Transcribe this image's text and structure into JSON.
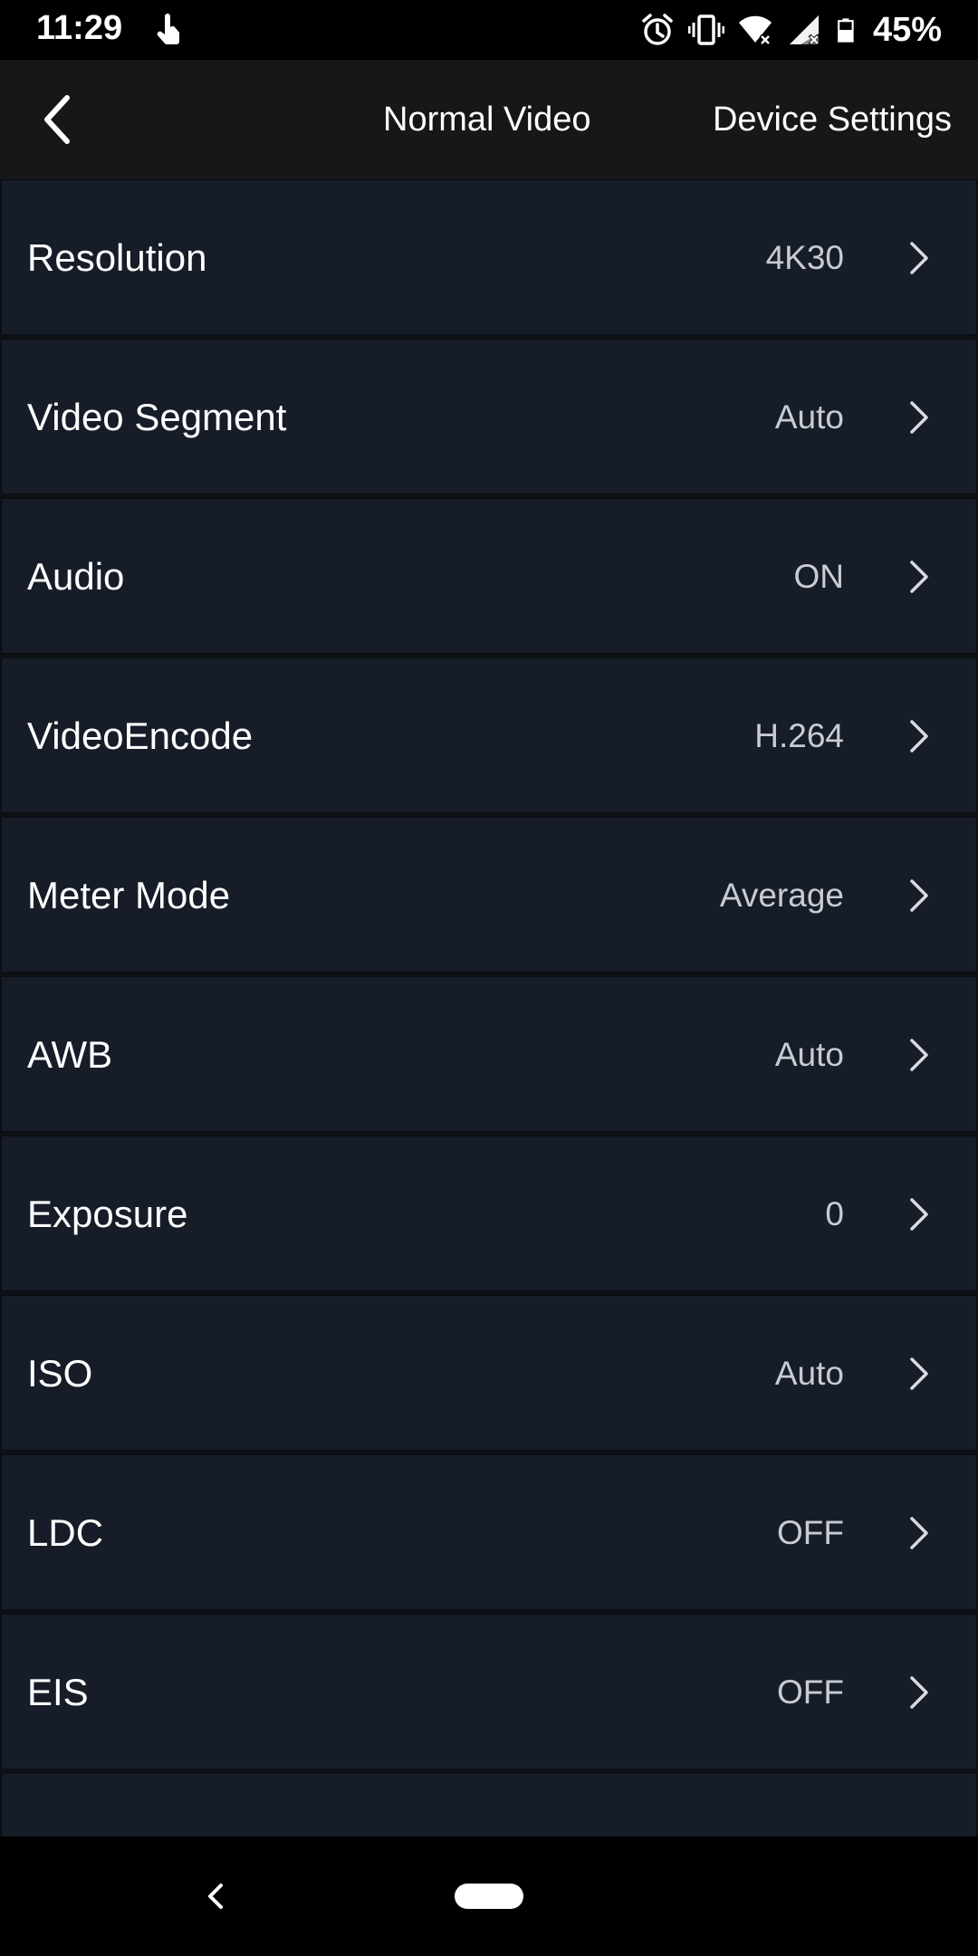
{
  "status_bar": {
    "time": "11:29",
    "battery": "45%",
    "icons": [
      "touch-icon",
      "alarm-icon",
      "vibrate-icon",
      "wifi-icon",
      "signal-icon",
      "battery-icon"
    ]
  },
  "header": {
    "back_icon": "back-arrow-icon",
    "tabs": [
      {
        "label": "Normal Video"
      },
      {
        "label": "Device Settings"
      }
    ]
  },
  "settings": {
    "items": [
      {
        "label": "Resolution",
        "value": "4K30"
      },
      {
        "label": "Video Segment",
        "value": "Auto"
      },
      {
        "label": "Audio",
        "value": "ON"
      },
      {
        "label": "VideoEncode",
        "value": "H.264"
      },
      {
        "label": "Meter Mode",
        "value": "Average"
      },
      {
        "label": "AWB",
        "value": "Auto"
      },
      {
        "label": "Exposure",
        "value": "0"
      },
      {
        "label": "ISO",
        "value": "Auto"
      },
      {
        "label": "LDC",
        "value": "OFF"
      },
      {
        "label": "EIS",
        "value": "OFF"
      }
    ]
  },
  "nav_bar": {
    "icons": [
      "nav-back-icon",
      "home-pill-icon"
    ]
  },
  "colors": {
    "background": "#000000",
    "header": "#161718",
    "row": "#161d28",
    "text": "#ffffff",
    "value_text": "#c8ccd2"
  }
}
